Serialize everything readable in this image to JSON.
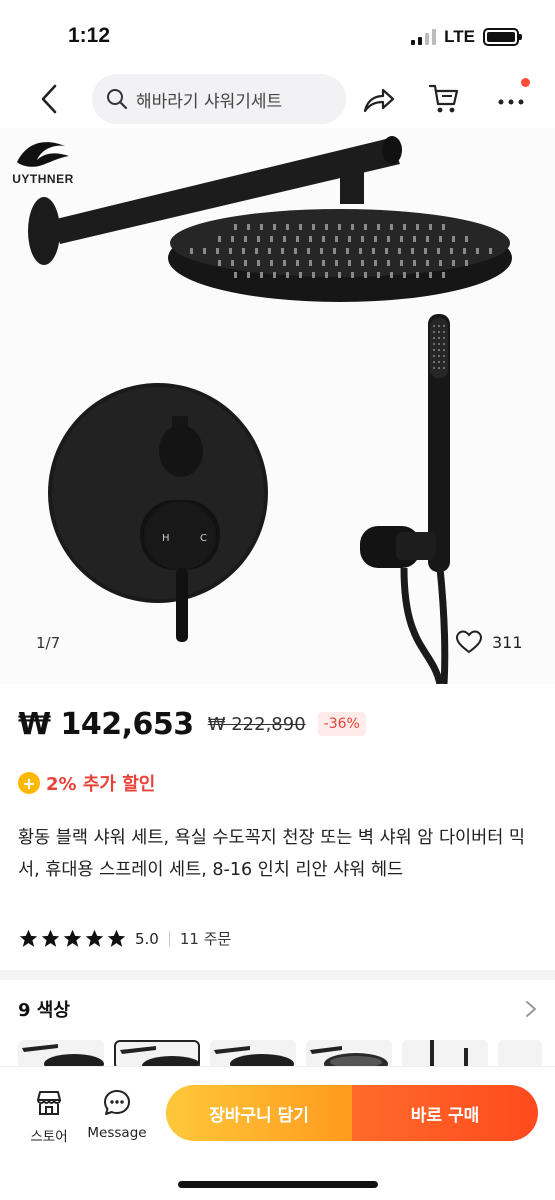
{
  "status": {
    "time": "1:12",
    "network": "LTE"
  },
  "nav": {
    "search_text": "해바라기 샤워기세트"
  },
  "hero": {
    "brand": "UYTHNER",
    "counter": "1/7",
    "wishlist_count": "311",
    "mixer_hot": "H",
    "mixer_cold": "C"
  },
  "price": {
    "current": "₩ 142,653",
    "original": "₩ 222,890",
    "discount": "-36%"
  },
  "extra_discount": {
    "icon": "+",
    "text": "2% 추가 할인"
  },
  "product": {
    "title": "황동 블랙 샤워 세트, 욕실 수도꼭지 천장 또는 벽 샤워 암 다이버터 믹서, 휴대용 스프레이 세트, 8-16 인치 리안 샤워 헤드",
    "rating": "5.0",
    "orders": "11 주문"
  },
  "colors": {
    "label": "9 색상"
  },
  "bottom": {
    "store_label": "스토어",
    "message_label": "Message",
    "add_to_cart": "장바구니 담기",
    "buy_now": "바로 구매"
  },
  "accent": {
    "orange": "#ff9a1f",
    "red": "#ff4a1e",
    "discount_red": "#e8433a"
  }
}
